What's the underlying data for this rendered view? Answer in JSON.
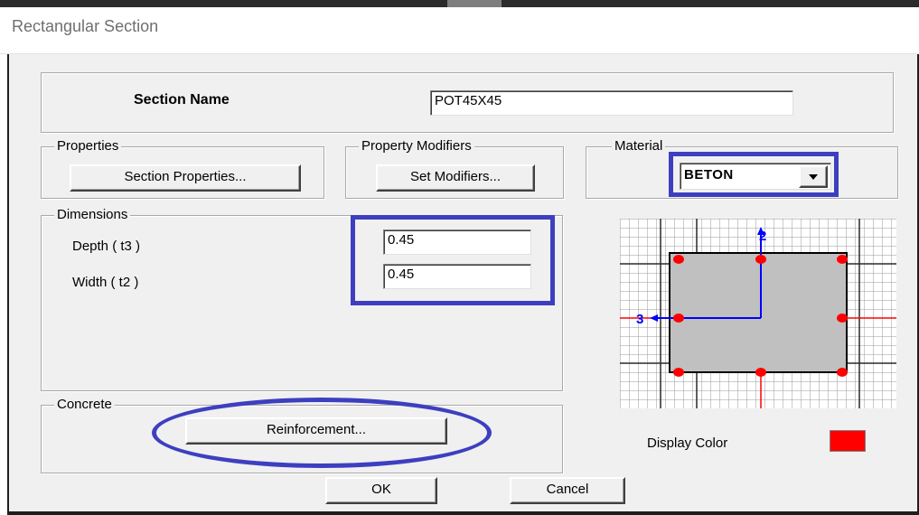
{
  "window": {
    "title": "Rectangular Section"
  },
  "section_name": {
    "label": "Section Name",
    "value": "POT45X45"
  },
  "properties": {
    "group_label": "Properties",
    "button_label": "Section Properties..."
  },
  "property_modifiers": {
    "group_label": "Property Modifiers",
    "button_label": "Set Modifiers..."
  },
  "material": {
    "group_label": "Material",
    "selected": "BETON"
  },
  "dimensions": {
    "group_label": "Dimensions",
    "depth": {
      "label": "Depth  ( t3 )",
      "value": "0.45"
    },
    "width": {
      "label": "Width  ( t2 )",
      "value": "0.45"
    }
  },
  "concrete": {
    "group_label": "Concrete",
    "button_label": "Reinforcement..."
  },
  "preview": {
    "axis_2_label": "2",
    "axis_3_label": "3",
    "section_color": "#c0c0c0",
    "rebar_color": "#ff0000",
    "axis_color": "#0000ff"
  },
  "display_color": {
    "label": "Display Color",
    "value": "#ff0000"
  },
  "actions": {
    "ok_label": "OK",
    "cancel_label": "Cancel"
  },
  "annotations": {
    "highlight_color": "#3d3fc0"
  }
}
